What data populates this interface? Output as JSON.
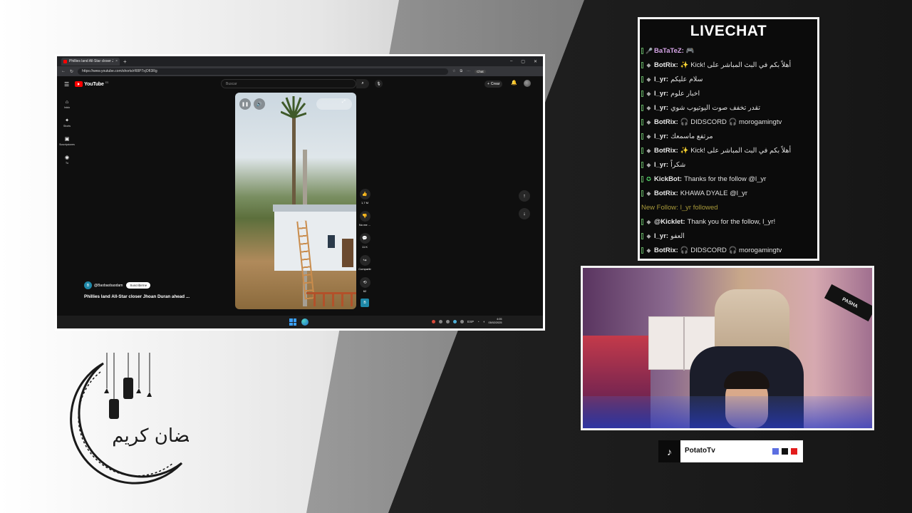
{
  "browser": {
    "tab_title": "Phillies land All-Star closer Jh...",
    "tab_close": "×",
    "new_tab": "+",
    "window_controls": [
      "–",
      "▢",
      "✕"
    ],
    "url": "https://www.youtube.com/shorts/rR8P7xjOfI3Rg",
    "chat_label": "Chat"
  },
  "youtube": {
    "logo_text": "YouTube",
    "country": "ES",
    "search_placeholder": "Buscar",
    "create_label": "Crear",
    "sidebar": [
      {
        "icon": "home-icon",
        "glyph": "⌂",
        "label": "Inicio"
      },
      {
        "icon": "shorts-icon",
        "glyph": "✦",
        "label": "Shorts"
      },
      {
        "icon": "subscriptions-icon",
        "glyph": "▣",
        "label": "Suscripciones"
      },
      {
        "icon": "you-icon",
        "glyph": "◉",
        "label": "Tú"
      }
    ],
    "actions": [
      {
        "icon": "like-icon",
        "glyph": "👍",
        "count": "1,7 M"
      },
      {
        "icon": "dislike-icon",
        "glyph": "👎",
        "count": "No me ..."
      },
      {
        "icon": "comment-icon",
        "glyph": "💬",
        "count": "11 K"
      },
      {
        "icon": "share-icon",
        "glyph": "↪",
        "count": "Compartir"
      },
      {
        "icon": "remix-icon",
        "glyph": "⟲",
        "count": "62"
      }
    ],
    "channel_initial": "B",
    "channel_name": "@Baobaobaodam",
    "subscribe_label": "Suscribirme",
    "video_title": "Phillies land All-Star closer Jhoan Duran ahead ..."
  },
  "taskbar": {
    "tray_lang": "ESP",
    "time": "4:05",
    "date": "05/02/2025"
  },
  "livechat": {
    "title": "LIVECHAT",
    "messages": [
      {
        "icon": "🎤",
        "user": "BaTaTeZ:",
        "body": "🎮",
        "pink": true
      },
      {
        "icon": "◆",
        "user": "BotRix:",
        "body": "✨ Kick! أهلاً بكم في البث المباشر على"
      },
      {
        "icon": "◆",
        "user": "l_yr:",
        "body": "سلام عليكم"
      },
      {
        "icon": "◆",
        "user": "l_yr:",
        "body": "اخبار علوم"
      },
      {
        "icon": "◆",
        "user": "l_yr:",
        "body": "تقدر تخفف صوت اليوتيوب شوي"
      },
      {
        "icon": "◆",
        "user": "BotRix:",
        "body": "🎧 DIDSCORD 🎧 morogamingtv"
      },
      {
        "icon": "◆",
        "user": "l_yr:",
        "body": "مرتفع ماسمعك"
      },
      {
        "icon": "◆",
        "user": "BotRix:",
        "body": "✨ Kick! أهلاً بكم في البث المباشر على"
      },
      {
        "icon": "◆",
        "user": "l_yr:",
        "body": "شكراً"
      },
      {
        "icon": "✪",
        "user": "KickBot:",
        "body": "Thanks for the follow @l_yr",
        "green": true
      },
      {
        "icon": "◆",
        "user": "BotRix:",
        "body": "KHAWA DYALE @l_yr"
      }
    ],
    "follow_event": {
      "label": "New Follow:",
      "body": "l_yr followed"
    },
    "messages_after": [
      {
        "icon": "◆",
        "user": "@Kicklet:",
        "body": "Thank you for the follow, l_yr!"
      },
      {
        "icon": "◆",
        "user": "l_yr:",
        "body": "العفو"
      },
      {
        "icon": "◆",
        "user": "BotRix:",
        "body": "🎧 DIDSCORD 🎧 morogamingtv"
      }
    ]
  },
  "webcam": {
    "flag_text": "PASHA"
  },
  "tiktok": {
    "icon": "tiktok-icon",
    "name": "PotatoTv",
    "squares": [
      "#5b6ee1",
      "#111111",
      "#e21b1b"
    ]
  },
  "decoration": {
    "ramadan_text": "رمضان كريم"
  }
}
